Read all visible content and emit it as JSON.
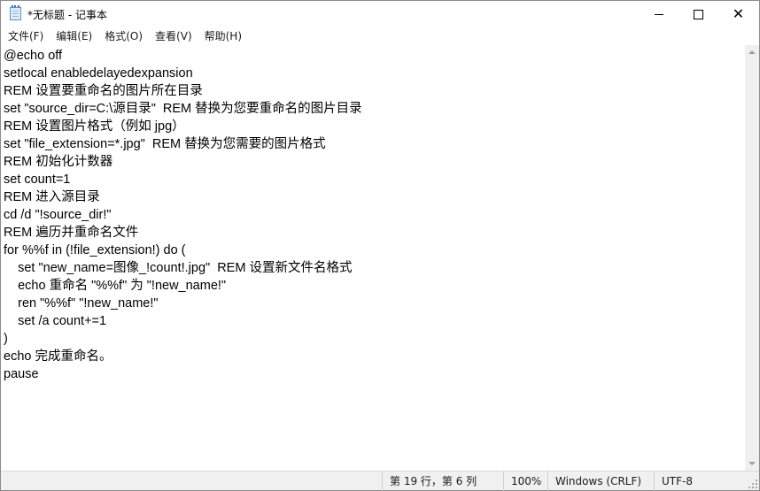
{
  "window": {
    "title": "*无标题 - 记事本",
    "app_icon": "notepad-icon",
    "controls": {
      "minimize": "minimize-icon",
      "maximize": "maximize-icon",
      "close": "close-icon",
      "close_glyph": "✕"
    }
  },
  "menu": {
    "items": [
      {
        "label": "文件(F)"
      },
      {
        "label": "编辑(E)"
      },
      {
        "label": "格式(O)"
      },
      {
        "label": "查看(V)"
      },
      {
        "label": "帮助(H)"
      }
    ]
  },
  "editor": {
    "lines": [
      "@echo off",
      "setlocal enabledelayedexpansion",
      "REM 设置要重命名的图片所在目录",
      "set \"source_dir=C:\\源目录\"  REM 替换为您要重命名的图片目录",
      "REM 设置图片格式（例如 jpg）",
      "set \"file_extension=*.jpg\"  REM 替换为您需要的图片格式",
      "REM 初始化计数器",
      "set count=1",
      "REM 进入源目录",
      "cd /d \"!source_dir!\"",
      "REM 遍历并重命名文件",
      "for %%f in (!file_extension!) do (",
      "    set \"new_name=图像_!count!.jpg\"  REM 设置新文件名格式",
      "    echo 重命名 \"%%f\" 为 \"!new_name!\"",
      "    ren \"%%f\" \"!new_name!\"",
      "    set /a count+=1",
      ")",
      "echo 完成重命名。",
      "pause"
    ]
  },
  "status": {
    "position": "第 19 行，第 6 列",
    "zoom": "100%",
    "line_ending": "Windows (CRLF)",
    "encoding": "UTF-8"
  }
}
